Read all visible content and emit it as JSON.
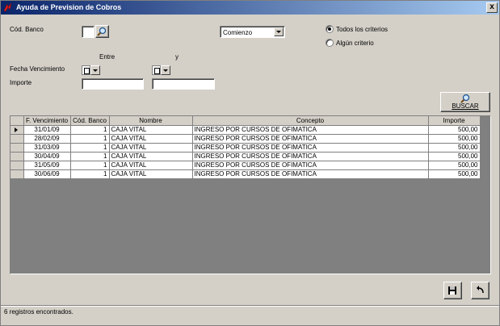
{
  "window": {
    "title": "Ayuda de Prevision de Cobros",
    "close_label": "x"
  },
  "form": {
    "cod_banco_label": "Cód. Banco",
    "match_mode": "Comienzo",
    "todos_label": "Todos los criterios",
    "alguno_label": "Algún criterio",
    "entre_label": "Entre",
    "y_label": "y",
    "fecha_label": "Fecha Vencimiento",
    "importe_label": "Importe",
    "buscar_label": "BUSCAR"
  },
  "table": {
    "columns": [
      "F. Vencimiento",
      "Cód. Banco",
      "Nombre",
      "Concepto",
      "Importe"
    ],
    "rows": [
      [
        "31/01/09",
        "1",
        "CAJA VITAL",
        "INGRESO POR CURSOS DE OFIMATICA",
        "500,00"
      ],
      [
        "28/02/09",
        "1",
        "CAJA VITAL",
        "INGRESO POR CURSOS DE OFIMATICA",
        "500,00"
      ],
      [
        "31/03/09",
        "1",
        "CAJA VITAL",
        "INGRESO POR CURSOS DE OFIMATICA",
        "500,00"
      ],
      [
        "30/04/09",
        "1",
        "CAJA VITAL",
        "INGRESO POR CURSOS DE OFIMATICA",
        "500,00"
      ],
      [
        "31/05/09",
        "1",
        "CAJA VITAL",
        "INGRESO POR CURSOS DE OFIMATICA",
        "500,00"
      ],
      [
        "30/06/09",
        "1",
        "CAJA VITAL",
        "INGRESO POR CURSOS DE OFIMATICA",
        "500,00"
      ]
    ]
  },
  "status": {
    "text": "6 registros encontrados."
  }
}
